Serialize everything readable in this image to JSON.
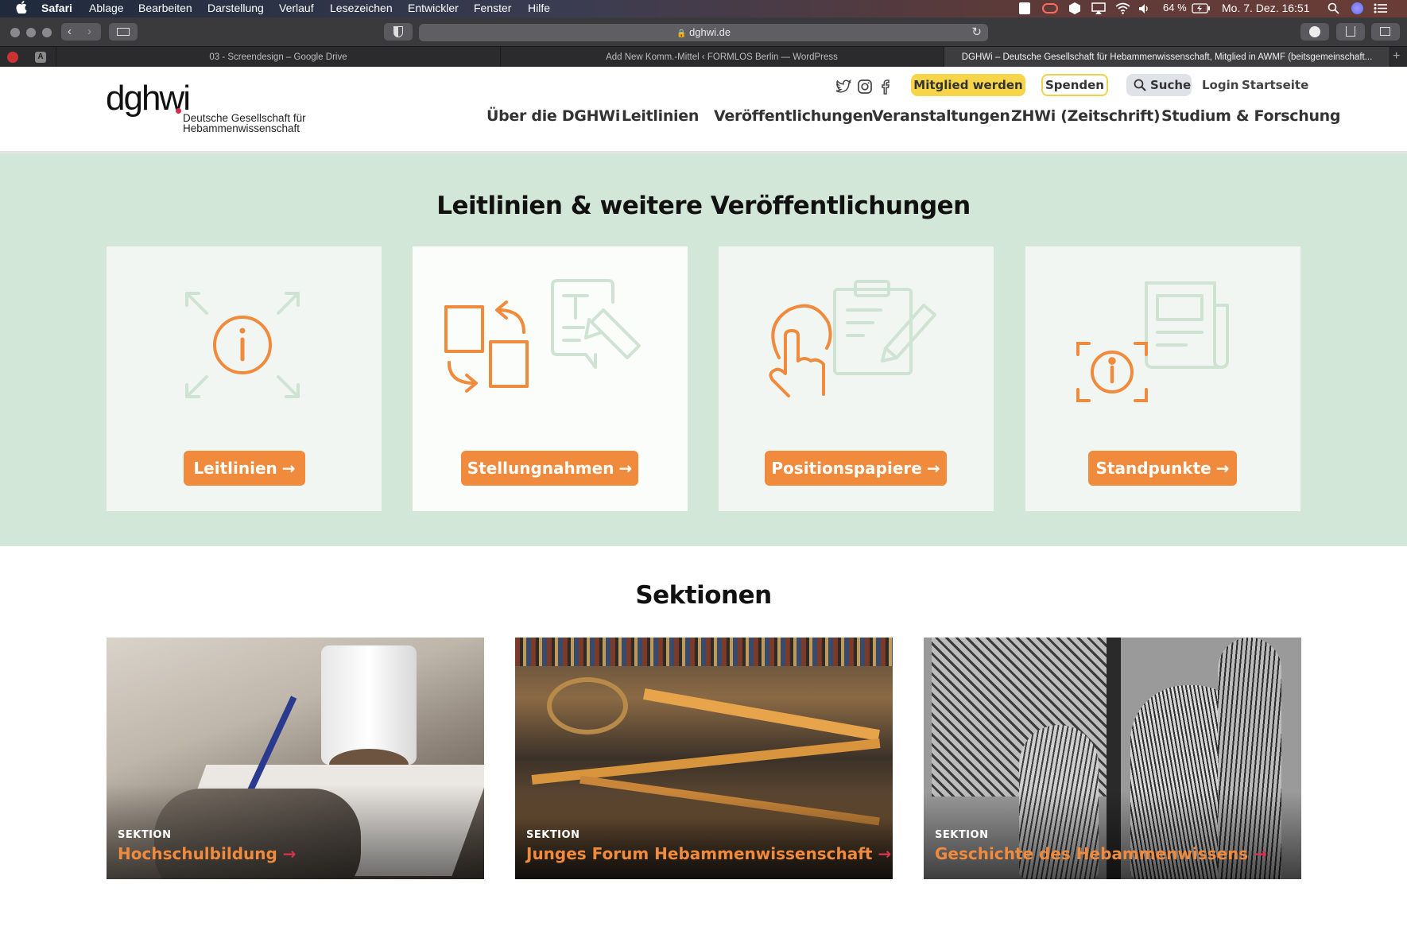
{
  "menubar": {
    "app": "Safari",
    "items": [
      "Ablage",
      "Bearbeiten",
      "Darstellung",
      "Verlauf",
      "Lesezeichen",
      "Entwickler",
      "Fenster",
      "Hilfe"
    ],
    "battery": "64 %",
    "datetime": "Mo. 7. Dez. 16:51"
  },
  "browser": {
    "url": "dghwi.de",
    "tabs": [
      {
        "title": "03 - Screendesign – Google Drive"
      },
      {
        "title": "Add New Komm.-Mittel ‹ FORMLOS Berlin — WordPress"
      },
      {
        "title": "DGHWi – Deutsche Gesellschaft für Hebammenwissenschaft, Mitglied in AWMF (beitsgemeinschaft..."
      }
    ]
  },
  "header": {
    "logo_text": "dghwi",
    "logo_sub_1": "Deutsche Gesellschaft für",
    "logo_sub_2": "Hebammenwissenschaft",
    "member_button": "Mitglied werden",
    "donate_button": "Spenden",
    "search_button": "Suche",
    "login": "Login",
    "home": "Startseite",
    "nav": [
      "Über die DGHWi",
      "Leitlinien",
      "Veröffentlichungen",
      "Veranstaltungen",
      "ZHWi (Zeitschrift)",
      "Studium & Forschung"
    ]
  },
  "publications": {
    "title": "Leitlinien & weitere Veröffentlichungen",
    "cards": [
      {
        "label": "Leitlinien",
        "arrow": "→"
      },
      {
        "label": "Stellungnahmen",
        "arrow": "→"
      },
      {
        "label": "Positionspapiere",
        "arrow": "→"
      },
      {
        "label": "Standpunkte",
        "arrow": "→"
      }
    ]
  },
  "sections": {
    "title": "Sektionen",
    "items": [
      {
        "kicker": "SEKTION",
        "title": "Hochschulbildung",
        "arrow": "→"
      },
      {
        "kicker": "SEKTION",
        "title": "Junges Forum Hebammenwissenschaft",
        "arrow": "→"
      },
      {
        "kicker": "SEKTION",
        "title": "Geschichte des Hebammenwissens",
        "arrow": "→"
      }
    ]
  },
  "colors": {
    "accent": "#f08a3c",
    "green_bg": "#d3e7d8",
    "member_yellow": "#f7d54a",
    "logo_red": "#d62d4f"
  }
}
